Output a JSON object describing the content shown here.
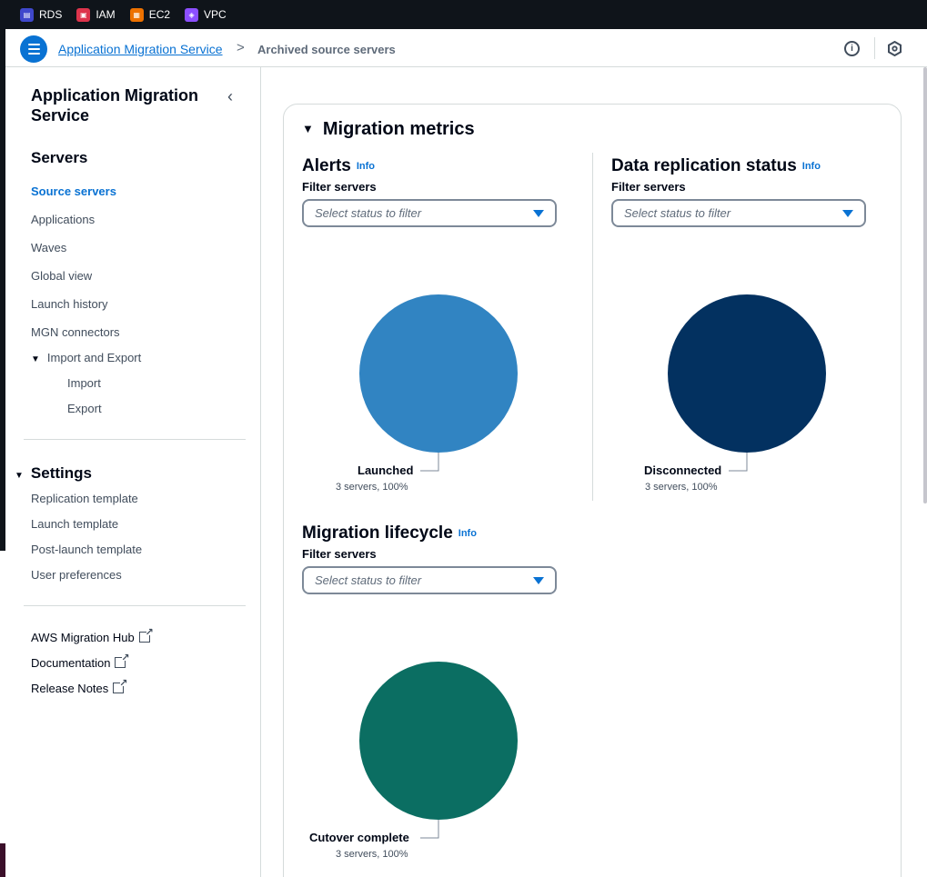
{
  "topbar": {
    "services": [
      {
        "label": "RDS",
        "icon": "rds-icon",
        "color": "#3f48cc"
      },
      {
        "label": "IAM",
        "icon": "iam-icon",
        "color": "#dd344c"
      },
      {
        "label": "EC2",
        "icon": "ec2-icon",
        "color": "#ed7100"
      },
      {
        "label": "VPC",
        "icon": "vpc-icon",
        "color": "#8c4fff"
      }
    ]
  },
  "breadcrumb": {
    "home": "Application Migration Service",
    "separator": ">",
    "current": "Archived source servers",
    "info_icon": "i"
  },
  "sidenav": {
    "title": "Application Migration Service",
    "collapse_icon": "‹",
    "servers_heading": "Servers",
    "servers_items": [
      "Source servers",
      "Applications",
      "Waves",
      "Global view",
      "Launch history",
      "MGN connectors"
    ],
    "active_item": "Source servers",
    "import_export": {
      "label": "Import and Export",
      "children": [
        "Import",
        "Export"
      ]
    },
    "settings_heading": "Settings",
    "settings_items": [
      "Replication template",
      "Launch template",
      "Post-launch template",
      "User preferences"
    ],
    "links": [
      "AWS Migration Hub",
      "Documentation",
      "Release Notes"
    ]
  },
  "main": {
    "card_title": "Migration metrics",
    "alerts": {
      "title": "Alerts",
      "info": "Info",
      "filter_label": "Filter servers",
      "placeholder": "Select status to filter",
      "slice_label": "Launched",
      "slice_sub": "3 servers, 100%",
      "color": "#3184c2"
    },
    "replication": {
      "title": "Data replication status",
      "info": "Info",
      "filter_label": "Filter servers",
      "placeholder": "Select status to filter",
      "slice_label": "Disconnected",
      "slice_sub": "3 servers, 100%",
      "color": "#033160"
    },
    "lifecycle": {
      "title": "Migration lifecycle",
      "info": "Info",
      "filter_label": "Filter servers",
      "placeholder": "Select status to filter",
      "slice_label": "Cutover complete",
      "slice_sub": "3 servers, 100%",
      "color": "#0b6e62"
    }
  },
  "chart_data": [
    {
      "type": "pie",
      "title": "Alerts",
      "categories": [
        "Launched"
      ],
      "values": [
        3
      ],
      "percent": [
        100
      ]
    },
    {
      "type": "pie",
      "title": "Data replication status",
      "categories": [
        "Disconnected"
      ],
      "values": [
        3
      ],
      "percent": [
        100
      ]
    },
    {
      "type": "pie",
      "title": "Migration lifecycle",
      "categories": [
        "Cutover complete"
      ],
      "values": [
        3
      ],
      "percent": [
        100
      ]
    }
  ]
}
